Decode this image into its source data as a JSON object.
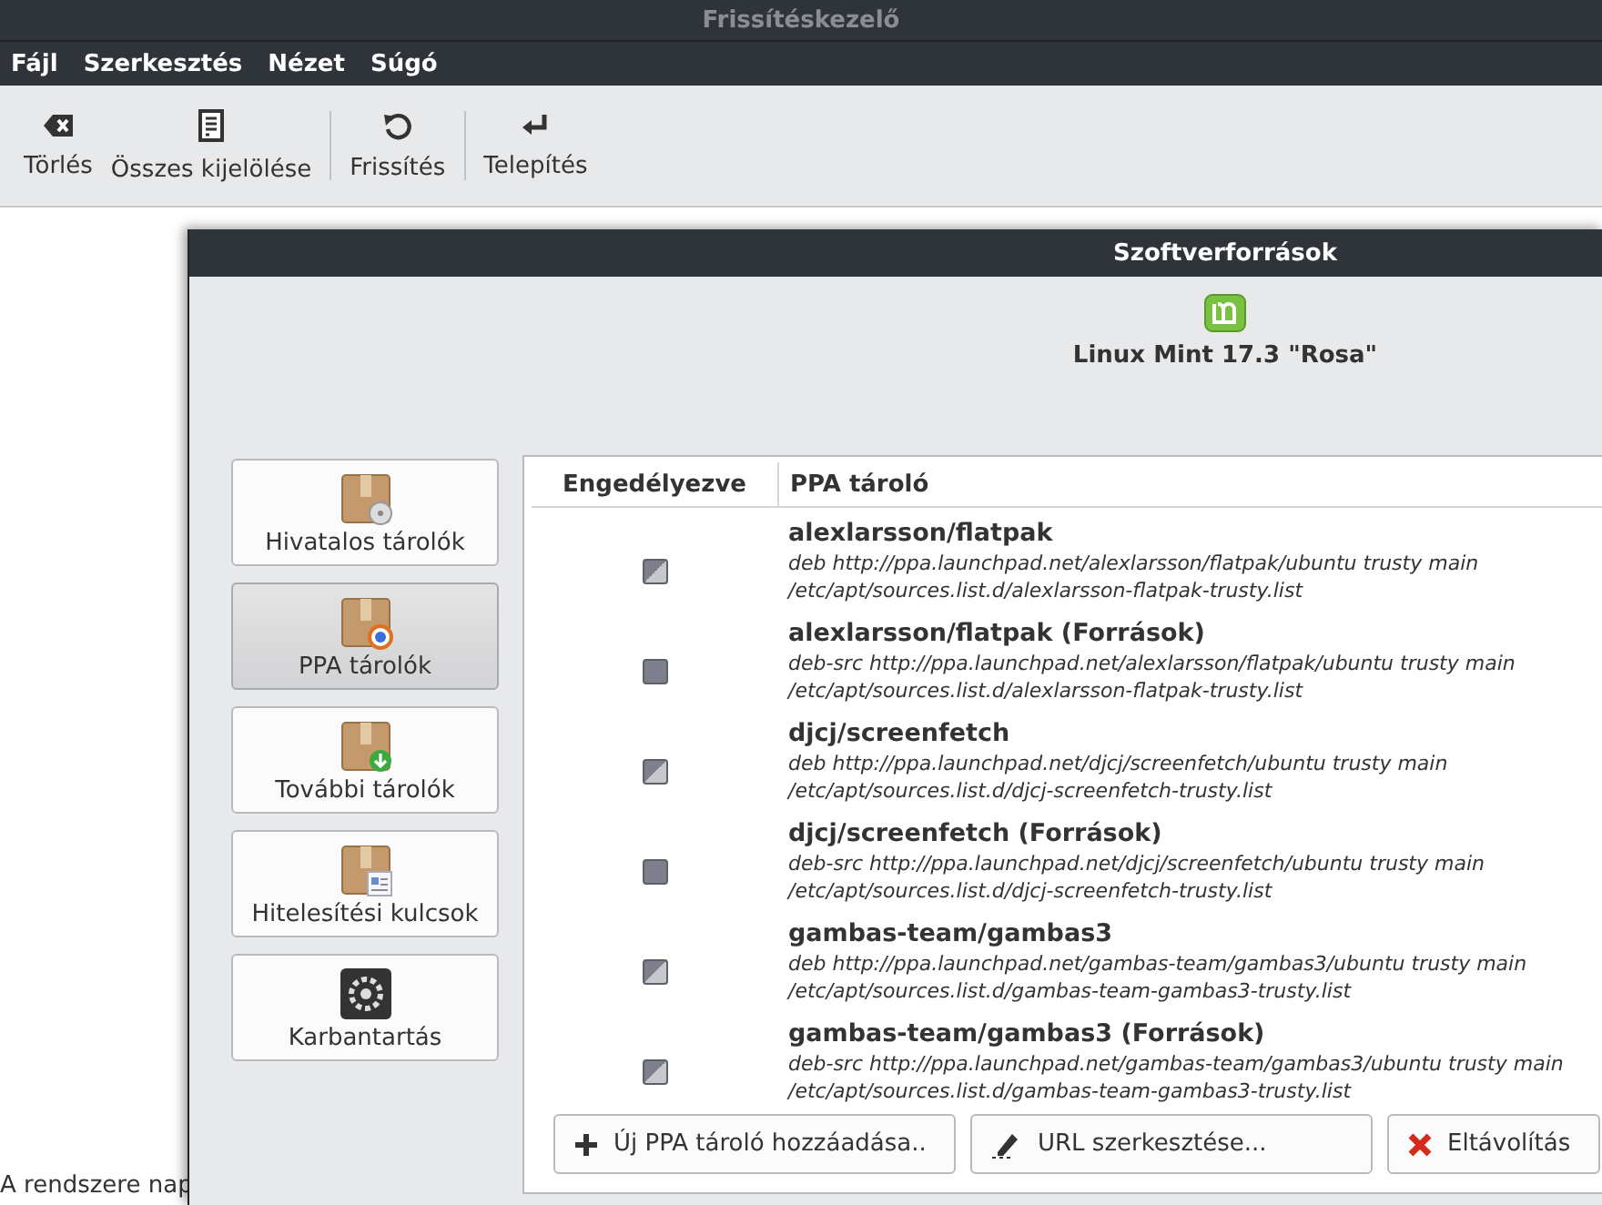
{
  "main_window": {
    "title": "Frissítéskezelő",
    "menu": [
      "Fájl",
      "Szerkesztés",
      "Nézet",
      "Súgó"
    ],
    "toolbar_groups": [
      [
        {
          "label": "Törlés",
          "kind": "clear"
        },
        {
          "label": "Összes kijelölése",
          "kind": "select_all"
        }
      ],
      [
        {
          "label": "Frissítés",
          "kind": "refresh"
        }
      ],
      [
        {
          "label": "Telepítés",
          "kind": "install"
        }
      ]
    ],
    "status_bar": "A rendszere nap"
  },
  "dialog": {
    "title": "Szoftverforrások",
    "heading": "Linux Mint 17.3 \"Rosa\"",
    "sidebar": [
      {
        "label": "Hivatalos tárolók",
        "kind": "official",
        "selected": false
      },
      {
        "label": "PPA tárolók",
        "kind": "ppa",
        "selected": true
      },
      {
        "label": "További tárolók",
        "kind": "additional",
        "selected": false
      },
      {
        "label": "Hitelesítési kulcsok",
        "kind": "keys",
        "selected": false
      },
      {
        "label": "Karbantartás",
        "kind": "maintenance",
        "selected": false
      }
    ],
    "table": {
      "columns": [
        "Engedélyezve",
        "PPA tároló"
      ],
      "rows": [
        {
          "enabled": true,
          "name": "alexlarsson/flatpak",
          "line": "deb http://ppa.launchpad.net/alexlarsson/flatpak/ubuntu trusty main",
          "file": "/etc/apt/sources.list.d/alexlarsson-flatpak-trusty.list"
        },
        {
          "enabled": false,
          "name": "alexlarsson/flatpak (Források)",
          "line": "deb-src http://ppa.launchpad.net/alexlarsson/flatpak/ubuntu trusty main",
          "file": "/etc/apt/sources.list.d/alexlarsson-flatpak-trusty.list"
        },
        {
          "enabled": true,
          "name": "djcj/screenfetch",
          "line": "deb http://ppa.launchpad.net/djcj/screenfetch/ubuntu trusty main",
          "file": "/etc/apt/sources.list.d/djcj-screenfetch-trusty.list"
        },
        {
          "enabled": false,
          "name": "djcj/screenfetch (Források)",
          "line": "deb-src http://ppa.launchpad.net/djcj/screenfetch/ubuntu trusty main",
          "file": "/etc/apt/sources.list.d/djcj-screenfetch-trusty.list"
        },
        {
          "enabled": true,
          "name": "gambas-team/gambas3",
          "line": "deb http://ppa.launchpad.net/gambas-team/gambas3/ubuntu trusty main",
          "file": "/etc/apt/sources.list.d/gambas-team-gambas3-trusty.list"
        },
        {
          "enabled": true,
          "name": "gambas-team/gambas3 (Források)",
          "line": "deb-src http://ppa.launchpad.net/gambas-team/gambas3/ubuntu trusty main",
          "file": "/etc/apt/sources.list.d/gambas-team-gambas3-trusty.list"
        }
      ]
    },
    "buttons": [
      {
        "label": "Új PPA tároló hozzáadása..",
        "kind": "add"
      },
      {
        "label": "URL szerkesztése...",
        "kind": "edit"
      },
      {
        "label": "Eltávolítás",
        "kind": "remove"
      }
    ]
  }
}
